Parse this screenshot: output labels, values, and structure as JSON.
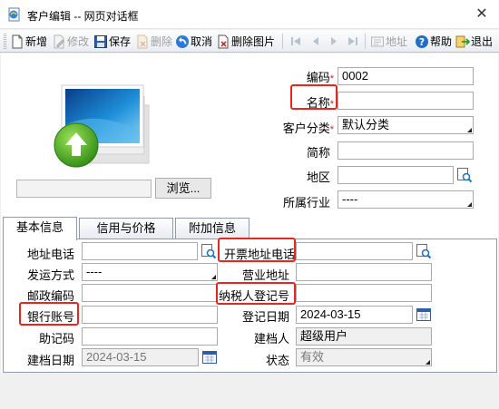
{
  "window": {
    "title": "客户编辑 -- 网页对话框",
    "close_glyph": "✕"
  },
  "toolbar": {
    "new": "新增",
    "edit": "修改",
    "save": "保存",
    "delete": "删除",
    "cancel": "取消",
    "delete_image": "删除图片",
    "address": "地址",
    "help": "帮助",
    "exit": "退出"
  },
  "image_panel": {
    "browse": "浏览..."
  },
  "form": {
    "code_label": "编码",
    "code_value": "0002",
    "name_label": "名称",
    "name_value": "",
    "category_label": "客户分类",
    "category_value": "默认分类",
    "short_label": "简称",
    "short_value": "",
    "region_label": "地区",
    "region_value": "",
    "industry_label": "所属行业",
    "industry_value": "----",
    "required_mark": "*"
  },
  "tabs": [
    {
      "label": "基本信息"
    },
    {
      "label": "信用与价格"
    },
    {
      "label": "附加信息"
    }
  ],
  "basic": {
    "address_phone_label": "地址电话",
    "address_phone_value": "",
    "invoice_address_label": "开票地址电话",
    "invoice_address_value": "",
    "ship_method_label": "发运方式",
    "ship_method_value": "----",
    "business_address_label": "营业地址",
    "business_address_value": "",
    "postcode_label": "邮政编码",
    "postcode_value": "",
    "taxpayer_label": "纳税人登记号",
    "taxpayer_value": "",
    "bank_label": "银行账号",
    "bank_value": "",
    "reg_date_label": "登记日期",
    "reg_date_value": "2024-03-15",
    "memo_label": "助记码",
    "memo_value": "",
    "creator_label": "建档人",
    "creator_value": "超级用户",
    "create_date_label": "建档日期",
    "create_date_value": "2024-03-15",
    "status_label": "状态",
    "status_value": "有效"
  },
  "colors": {
    "highlight": "#e8261e",
    "accent": "#1f6fc9",
    "required": "#e02020"
  }
}
